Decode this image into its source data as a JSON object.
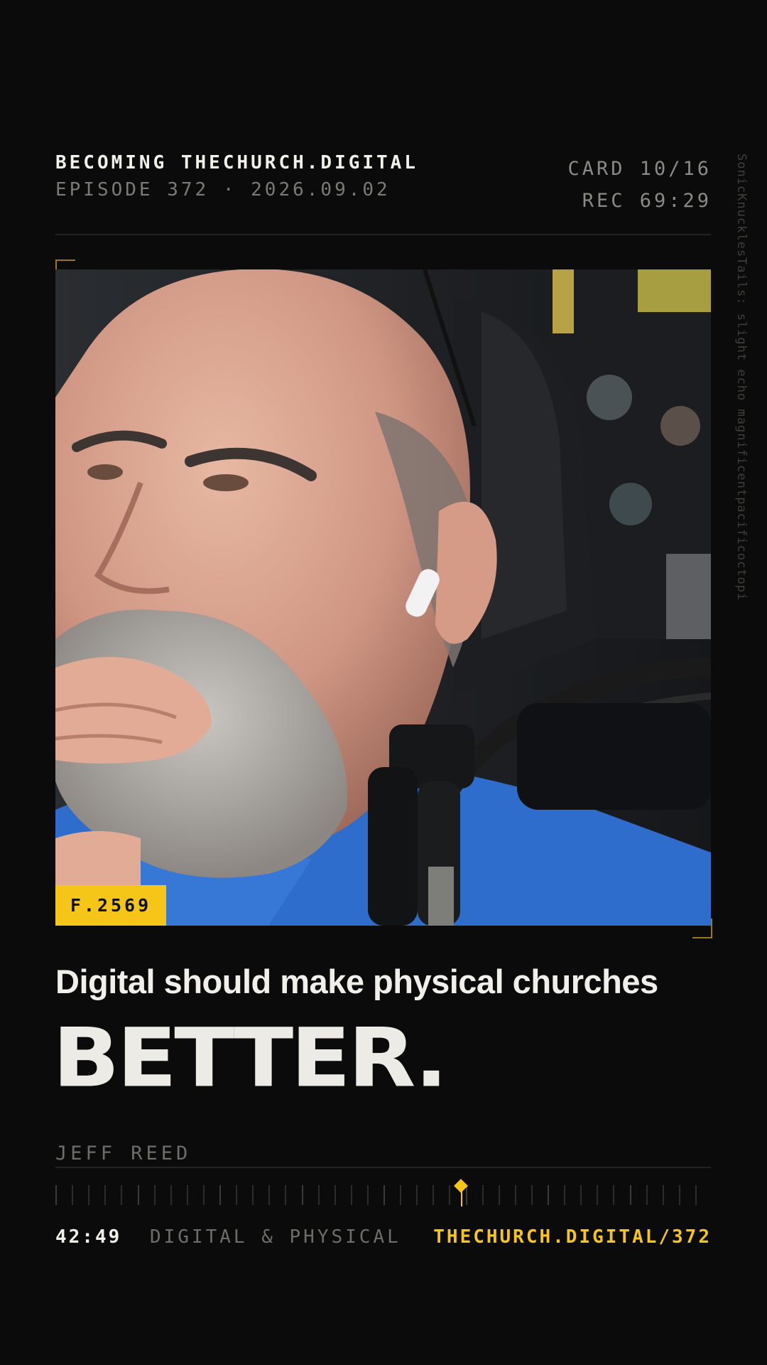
{
  "header": {
    "show_title": "BECOMING THECHURCH.DIGITAL",
    "episode": "EPISODE 372 · 2026.09.02",
    "card": "CARD 10/16",
    "rec": "REC 69:29"
  },
  "side_note": "SonicKnucklesTails: slight echo magnificentpacificoctopi",
  "photo": {
    "frame_badge": "F.2569"
  },
  "quote": {
    "line1": "Digital should make physical churches",
    "emphasis": "BETTER."
  },
  "speaker": "JEFF REED",
  "timeline": {
    "progress": 0.62
  },
  "footer": {
    "time": "42:49",
    "topic": "DIGITAL & PHYSICAL",
    "link": "THECHURCH.DIGITAL/372"
  },
  "colors": {
    "background": "#0b0b0b",
    "accent": "#f5c518",
    "text": "#ecebe6",
    "muted": "#6d6d69"
  }
}
